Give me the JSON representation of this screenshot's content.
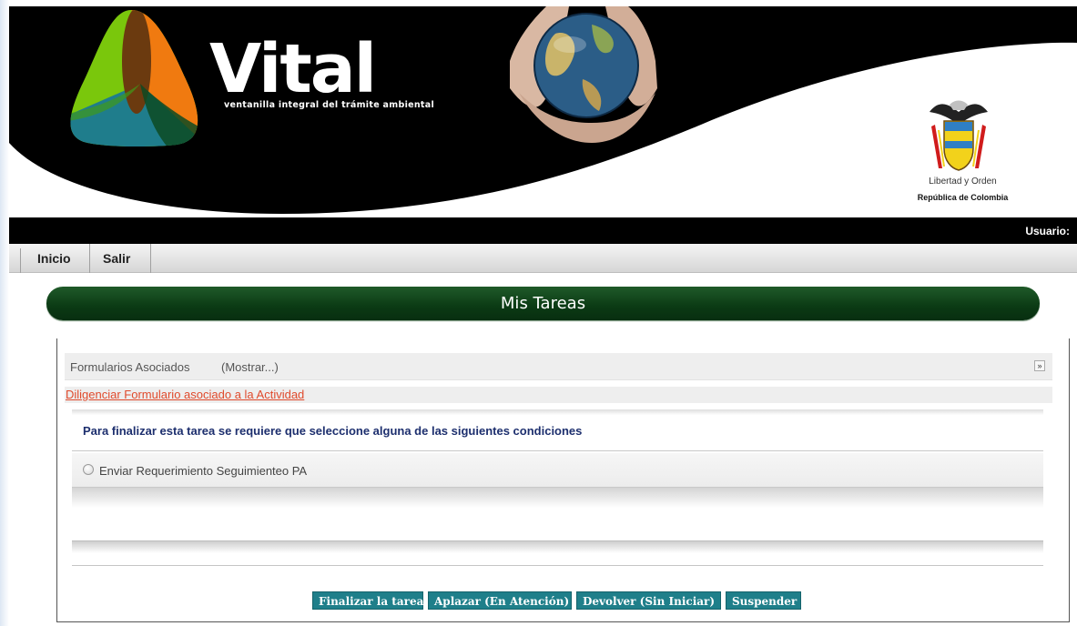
{
  "header": {
    "brand_title": "Vital",
    "brand_subtitle": "ventanilla integral del trámite ambiental",
    "crest_motto": "Libertad y Orden",
    "crest_country": "República de Colombia",
    "colors": {
      "logo_green": "#7ac70c",
      "logo_orange": "#f07a10",
      "logo_teal": "#1f7d8c",
      "logo_brown": "#6b3a0f",
      "header_black": "#000000"
    }
  },
  "user_bar": {
    "label": "Usuario:"
  },
  "nav": {
    "items": [
      {
        "label": "Inicio"
      },
      {
        "label": "Salir"
      }
    ]
  },
  "page": {
    "title": "Mis Tareas",
    "title_color": "#0b3a14"
  },
  "forms": {
    "title": "Formularios Asociados",
    "toggle_label": "(Mostrar...)",
    "expand_icon": "double-chevron-down-icon",
    "link_label": "Diligenciar Formulario asociado a la Actividad"
  },
  "conditions": {
    "instruction": "Para finalizar esta tarea se requiere que seleccione alguna de las siguientes condiciones",
    "options": [
      {
        "label": "Enviar Requerimiento Seguimienteo PA",
        "selected": false
      }
    ]
  },
  "actions": {
    "finalize_label": "Finalizar la tarea",
    "postpone_label": "Aplazar (En Atención)",
    "return_label": "Devolver (Sin Iniciar)",
    "suspend_label": "Suspender",
    "button_color": "#1f7f8a"
  }
}
